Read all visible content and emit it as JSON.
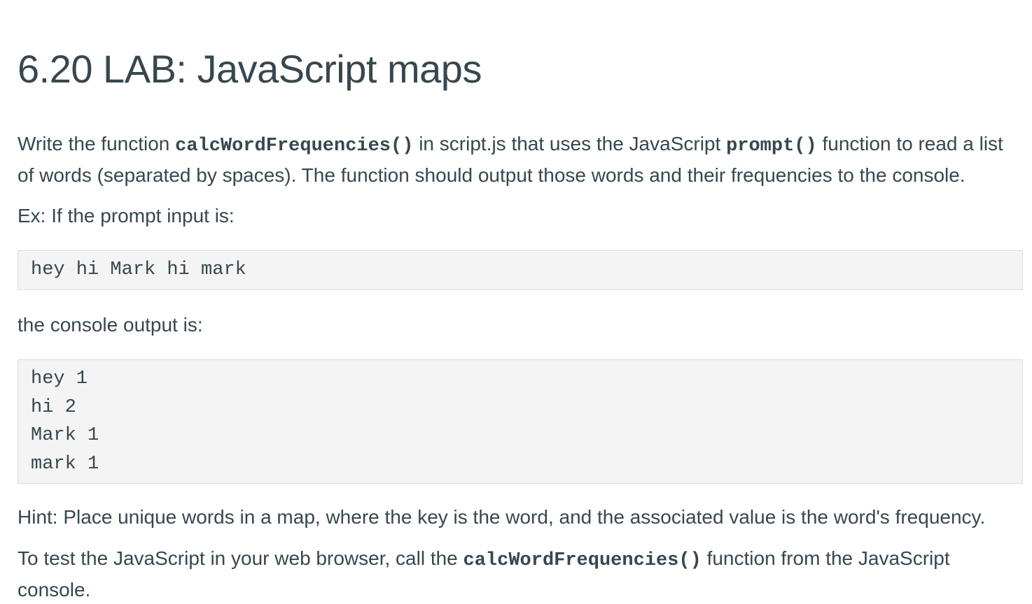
{
  "title": "6.20 LAB: JavaScript maps",
  "para1": {
    "text1": "Write the function ",
    "code1": "calcWordFrequencies()",
    "text2": " in script.js that uses the JavaScript ",
    "code2": "prompt()",
    "text3": " function to read a list of words (separated by spaces). The function should output those words and their frequencies to the console."
  },
  "para2": "Ex: If the prompt input is:",
  "input_example": "hey hi Mark hi mark",
  "para3": "the console output is:",
  "output_lines": [
    "hey 1",
    "hi 2",
    "Mark 1",
    "mark 1"
  ],
  "hint": "Hint: Place unique words in a map, where the key is the word, and the associated value is the word's frequency.",
  "para5": {
    "text1": "To test the JavaScript in your web browser, call the ",
    "code1": "calcWordFrequencies()",
    "text2": " function from the JavaScript console."
  }
}
